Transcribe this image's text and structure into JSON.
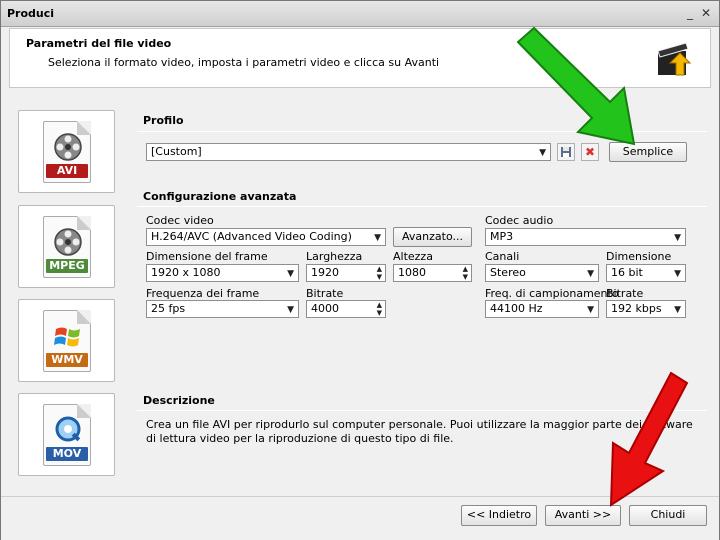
{
  "window": {
    "title": "Produci"
  },
  "header": {
    "title": "Parametri del file video",
    "subtitle": "Seleziona il formato video, imposta i parametri video e clicca su Avanti"
  },
  "formats": [
    {
      "label": "AVI",
      "color": "#b31b1b"
    },
    {
      "label": "MPEG",
      "color": "#4f8a3a"
    },
    {
      "label": "WMV",
      "color": "#c46a14"
    },
    {
      "label": "MOV",
      "color": "#2a5fa8"
    }
  ],
  "profile": {
    "section": "Profilo",
    "value": "[Custom]",
    "simple_button": "Semplice"
  },
  "advanced": {
    "section": "Configurazione avanzata",
    "video_codec_label": "Codec video",
    "video_codec_value": "H.264/AVC (Advanced Video Coding)",
    "advanced_button": "Avanzato...",
    "frame_size_label": "Dimensione del frame",
    "frame_size_value": "1920 x 1080",
    "width_label": "Larghezza",
    "width_value": "1920",
    "height_label": "Altezza",
    "height_value": "1080",
    "frame_rate_label": "Frequenza dei frame",
    "frame_rate_value": "25 fps",
    "bitrate_label": "Bitrate",
    "bitrate_value": "4000",
    "audio_codec_label": "Codec audio",
    "audio_codec_value": "MP3",
    "channels_label": "Canali",
    "channels_value": "Stereo",
    "sample_size_label": "Dimensione",
    "sample_size_value": "16 bit",
    "sample_rate_label": "Freq. di campionamento",
    "sample_rate_value": "44100 Hz",
    "audio_bitrate_label": "Bitrate",
    "audio_bitrate_value": "192 kbps"
  },
  "description": {
    "section": "Descrizione",
    "text": "Crea un file AVI per riprodurlo sul computer personale. Puoi utilizzare la maggior parte dei software di lettura video per la riproduzione di questo tipo di file."
  },
  "footer": {
    "back_button": "<< Indietro",
    "next_button": "Avanti >>",
    "close_button": "Chiudi"
  },
  "annotations": {
    "green_arrow_color": "#22c31b",
    "red_arrow_color": "#e81010"
  }
}
